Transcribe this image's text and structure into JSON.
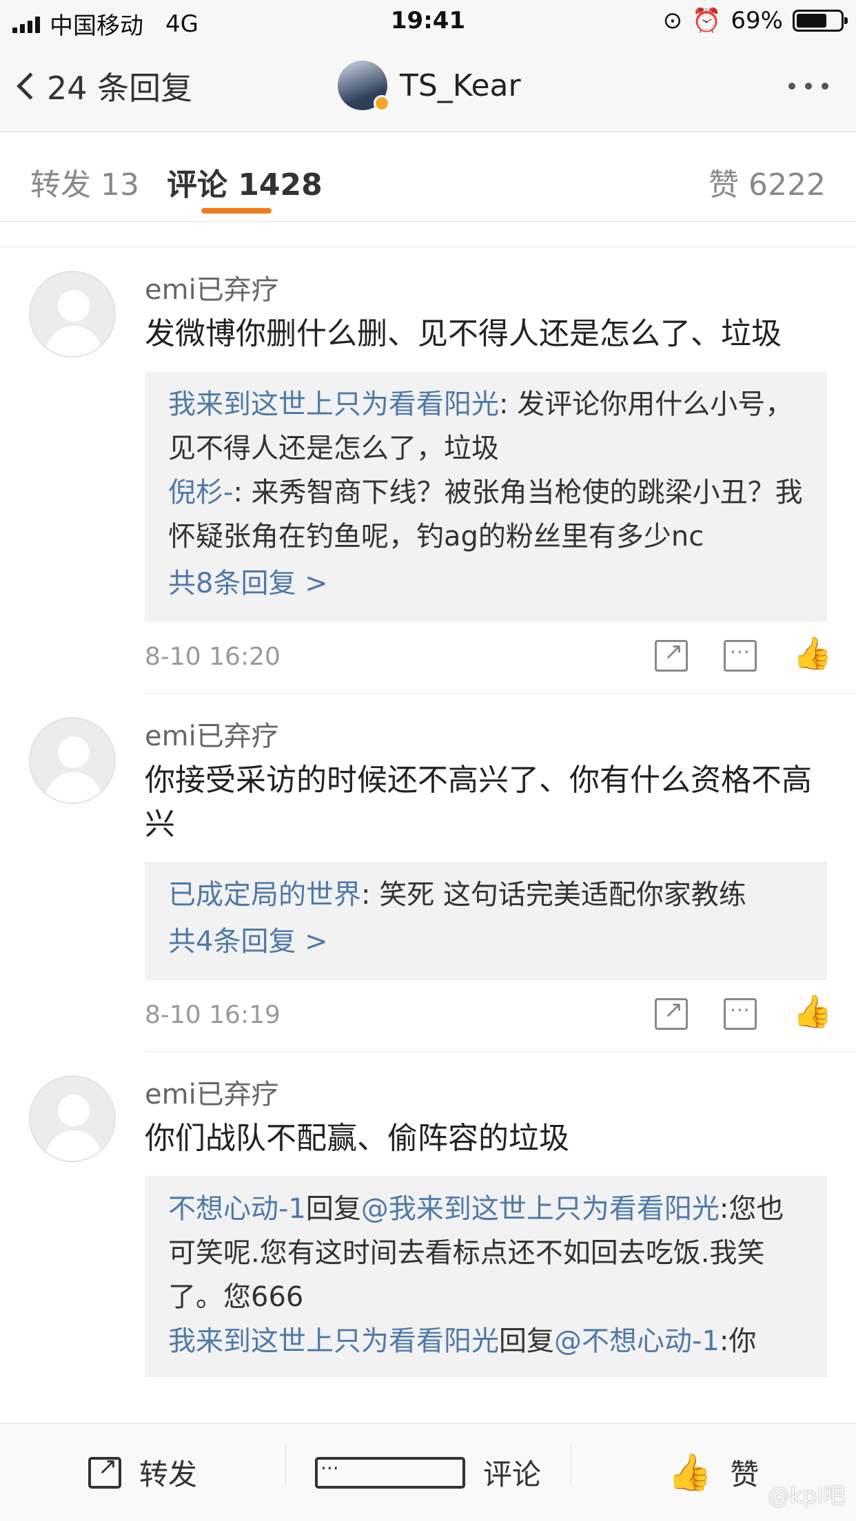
{
  "status_bar": {
    "carrier": "中国移动",
    "network": "4G",
    "time": "19:41",
    "battery": "69%"
  },
  "nav": {
    "back_label": "24 条回复",
    "title": "TS_Kear"
  },
  "tabs": [
    {
      "label": "转发 13"
    },
    {
      "label": "评论 1428"
    },
    {
      "label": "赞 6222"
    }
  ],
  "comments": [
    {
      "user": "emi已弃疗",
      "text": "发微博你删什么删、见不得人还是怎么了、垃圾",
      "replies": [
        {
          "user": "我来到这世上只为看看阳光",
          "text": ": 发评论你用什么小号，见不得人还是怎么了，垃圾"
        },
        {
          "user": "倪杉-",
          "text": ": 来秀智商下线？被张角当枪使的跳梁小丑？我怀疑张角在钓鱼呢，钓ag的粉丝里有多少nc"
        }
      ],
      "more": "共8条回复 >",
      "time": "8-10 16:20"
    },
    {
      "user": "emi已弃疗",
      "text": "你接受采访的时候还不高兴了、你有什么资格不高兴",
      "replies": [
        {
          "user": "已成定局的世界",
          "text": ": 笑死 这句话完美适配你家教练"
        }
      ],
      "more": "共4条回复 >",
      "time": "8-10 16:19"
    },
    {
      "user": "emi已弃疗",
      "text": "你们战队不配赢、偷阵容的垃圾",
      "replies": [
        {
          "user": "不想心动-1",
          "mid": "回复",
          "mention": "@我来到这世上只为看看阳光",
          "text": ":您也可笑呢.您有这时间去看标点还不如回去吃饭.我笑了。您666"
        },
        {
          "user": "我来到这世上只为看看阳光",
          "mid": "回复",
          "mention": "@不想心动-1",
          "text": ":你"
        }
      ]
    }
  ],
  "toolbar": {
    "repost": "转发",
    "comment": "评论",
    "like": "赞"
  },
  "watermark": "@kpl吧",
  "icons": {
    "back": "chevron-left-icon",
    "more": "more-dots-icon",
    "repost": "share-icon",
    "comment": "comment-icon",
    "like": "thumbs-up-icon"
  },
  "colors": {
    "accent": "#f07c1a",
    "link": "#4f79a8"
  }
}
